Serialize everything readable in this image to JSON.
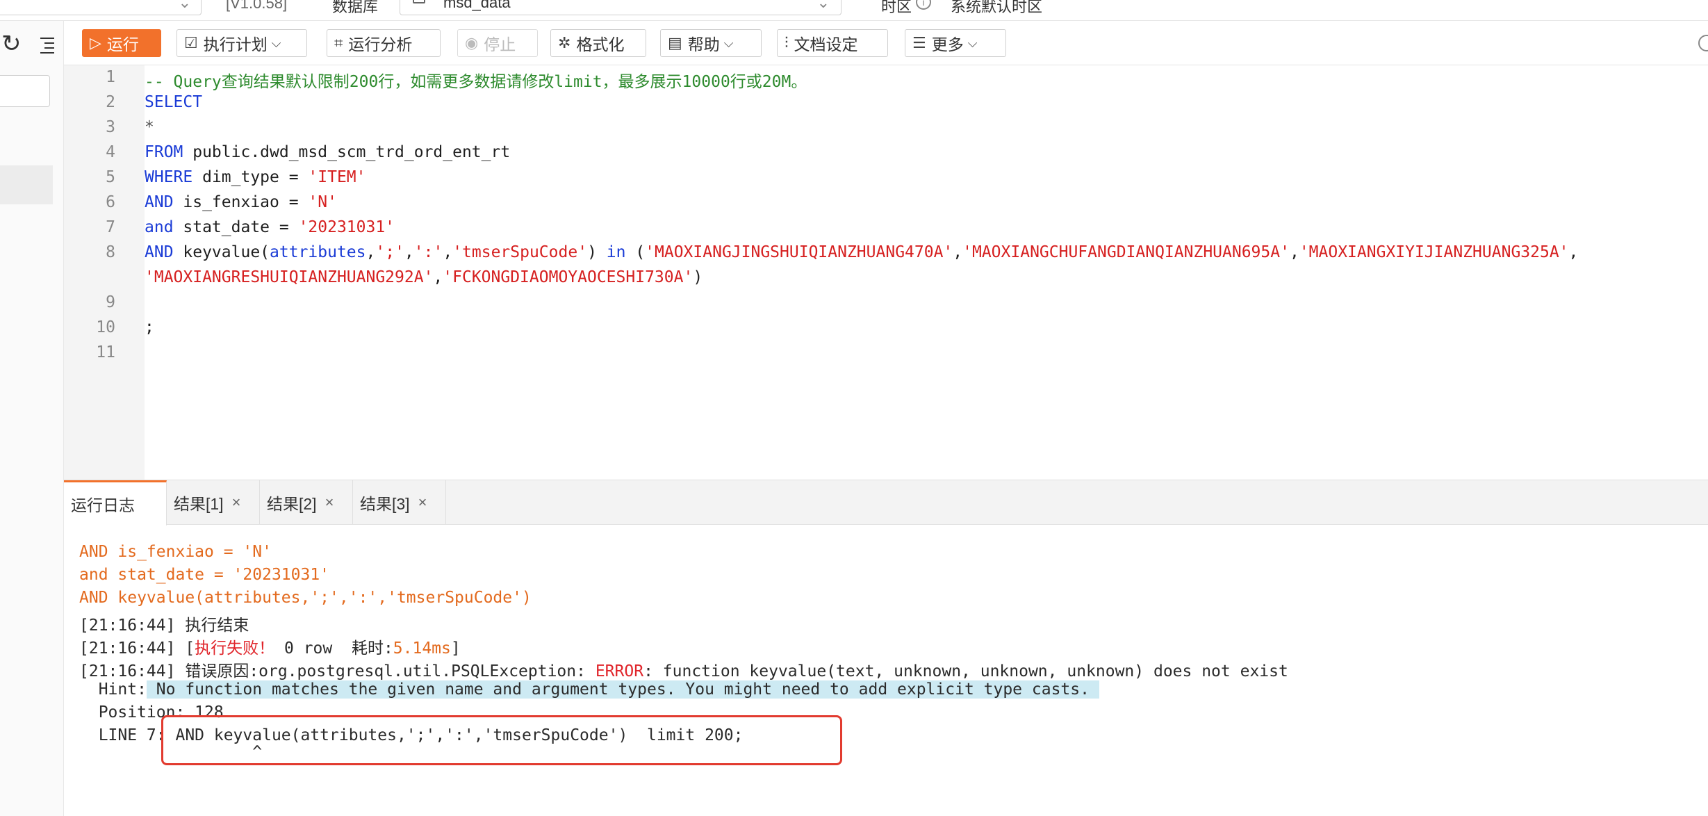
{
  "top": {
    "version_label": "[V1.0.58]",
    "database_label": "数据库",
    "database_value": "msd_data",
    "timezone_label": "时区",
    "timezone_value": "系统默认时区"
  },
  "toolbar": {
    "run": "运行",
    "exec_plan": "执行计划",
    "analyze": "运行分析",
    "stop": "停止",
    "format": "格式化",
    "help": "帮助",
    "doc_settings": "文档设定",
    "more": "更多"
  },
  "editor": {
    "line_numbers": [
      "1",
      "2",
      "3",
      "4",
      "5",
      "6",
      "7",
      "8",
      "9",
      "10",
      "11"
    ],
    "l1": "-- Query查询结果默认限制200行，如需更多数据请修改limit，最多展示10000行或20M。",
    "l2": "SELECT",
    "l3": "*",
    "l4_kw": "FROM",
    "l4_rest": " public.dwd_msd_scm_trd_ord_ent_rt",
    "l5_kw": "WHERE",
    "l5_mid": " dim_type = ",
    "l5_str": "'ITEM'",
    "l6_kw": "AND",
    "l6_mid": " is_fenxiao = ",
    "l6_str": "'N'",
    "l7_kw": "and",
    "l7_mid": " stat_date = ",
    "l7_str": "'20231031'",
    "l8_kw": "AND",
    "l8_fn": " keyvalue(",
    "l8_attr": "attributes",
    "l8_c1": ",",
    "l8_s1": "';'",
    "l8_c2": ",",
    "l8_s2": "':'",
    "l8_c3": ",",
    "l8_s3": "'tmserSpuCode'",
    "l8_close": ") ",
    "l8_in": "in",
    "l8_open": " (",
    "l8_v1": "'MAOXIANGJINGSHUIQIANZHUANG470A'",
    "l8_c4": ",",
    "l8_v2": "'MAOXIANGCHUFANGDIANQIANZHUAN695A'",
    "l8_c5": ",",
    "l8_v3": "'MAOXIANGXIYIJIANZHUANG325A'",
    "l8_c6": ",",
    "l8b_v4": "'MAOXIANGRESHUIQIANZHUANG292A'",
    "l8b_c": ",",
    "l8b_v5": "'FCKONGDIAOMOYAOCESHI730A'",
    "l8b_close": ")",
    "l10": ";"
  },
  "tabs": [
    {
      "label": "运行日志"
    },
    {
      "label": "结果[1]"
    },
    {
      "label": "结果[2]"
    },
    {
      "label": "结果[3]"
    }
  ],
  "log": {
    "o1": "AND is_fenxiao = 'N'",
    "o2": "and stat_date = '20231031'",
    "o3": "AND keyvalue(attributes,';',':','tmserSpuCode')",
    "l4": "[21:16:44] 执行结束",
    "l5_a": "[21:16:44] [",
    "l5_fail": "执行失败！",
    "l5_b": " 0 row  耗时:",
    "l5_time": "5.14ms",
    "l5_c": "]",
    "l6_a": "[21:16:44] 错误原因:org.postgresql.util.PSQLException: ",
    "l6_err": "ERROR",
    "l6_b": ": function keyvalue(text, unknown, unknown, unknown) does not exist",
    "l7_a": "  Hint:",
    "l7_hint": " No function matches the given name and argument types. You might need to add explicit type casts. ",
    "l8": "  Position: 128",
    "l9": "  LINE 7: AND keyvalue(attributes,';',':','tmserSpuCode')  limit 200;",
    "l10": "                  ^"
  },
  "colors": {
    "accent": "#f2712b",
    "keyword": "#1a3bd6",
    "string": "#d62020",
    "comment": "#2e8b2e",
    "hint_bg": "#cdeaf3",
    "highlight_box": "#e23b2f"
  }
}
